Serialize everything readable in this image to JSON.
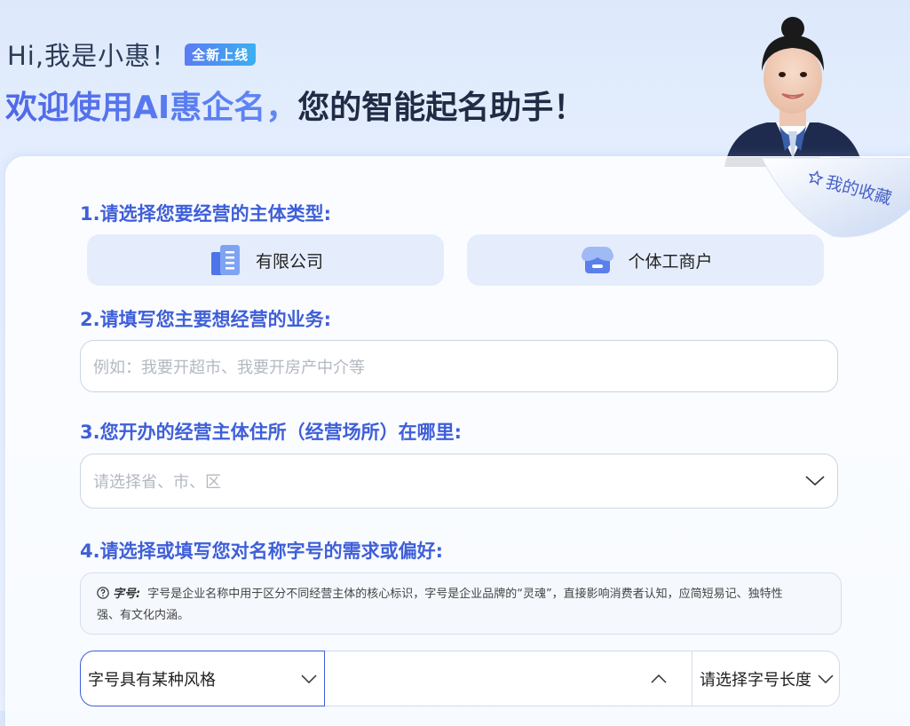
{
  "greeting": "Hi,我是小惠！",
  "badge": "全新上线",
  "welcome": {
    "highlight": "欢迎使用AI惠企名，",
    "rest": "您的智能起名助手！"
  },
  "favorites": {
    "label": "我的收藏",
    "icon": "star-icon"
  },
  "q1": {
    "title": "1.请选择您要经营的主体类型:",
    "options": [
      {
        "label": "有限公司",
        "icon": "building-icon"
      },
      {
        "label": "个体工商户",
        "icon": "shop-icon"
      }
    ]
  },
  "q2": {
    "title": "2.请填写您主要想经营的业务:",
    "placeholder": "例如：我要开超市、我要开房产中介等"
  },
  "q3": {
    "title": "3.您开办的经营主体住所（经营场所）在哪里:",
    "placeholder": "请选择省、市、区"
  },
  "q4": {
    "title": "4.请选择或填写您对名称字号的需求或偏好:",
    "tip_key": "字号:",
    "tip_text": "字号是企业名称中用于区分不同经营主体的核心标识，字号是企业品牌的“灵魂”，直接影响消费者认知，应简短易记、独特性强、有文化内涵。",
    "style_select": "字号具有某种风格",
    "length_select": "请选择字号长度"
  },
  "colors": {
    "accent": "#3f5fd8",
    "option_bg": "#e5edfc"
  }
}
